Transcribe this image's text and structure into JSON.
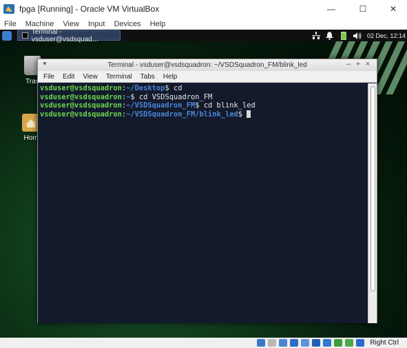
{
  "host_window": {
    "title": "fpga [Running] - Oracle VM VirtualBox",
    "controls": {
      "minimize": "—",
      "maximize": "☐",
      "close": "✕"
    },
    "menu": [
      "File",
      "Machine",
      "View",
      "Input",
      "Devices",
      "Help"
    ]
  },
  "guest_panel": {
    "task_label": "Terminal - vsduser@vsdsquad…",
    "clock": "02 Dec, 12:14"
  },
  "desktop": {
    "icons": [
      {
        "label": "Tras"
      },
      {
        "label": "Hom"
      }
    ]
  },
  "terminal": {
    "title": "Terminal - vsduser@vsdsquadron: ~/VSDSquadron_FM/blink_led",
    "controls": {
      "minimize": "‒",
      "maximize": "+",
      "close": "×"
    },
    "menu": [
      "File",
      "Edit",
      "View",
      "Terminal",
      "Tabs",
      "Help"
    ],
    "lines": [
      {
        "user": "vsduser@vsdsquadron",
        "sep": ":",
        "path": "~/Desktop",
        "prompt": "$ ",
        "cmd": "cd"
      },
      {
        "user": "vsduser@vsdsquadron",
        "sep": ":",
        "path": "~",
        "prompt": "$ ",
        "cmd": "cd VSDSquadron_FM"
      },
      {
        "user": "vsduser@vsdsquadron",
        "sep": ":",
        "path": "~/VSDSquadron_FM",
        "prompt": "$ ",
        "cmd": "cd blink_led"
      },
      {
        "user": "vsduser@vsdsquadron",
        "sep": ":",
        "path": "~/VSDSquadron_FM/blink_led",
        "prompt": "$ ",
        "cmd": ""
      }
    ]
  },
  "statusbar": {
    "host_key": "Right Ctrl",
    "icons": [
      {
        "name": "network-icon",
        "color": "#3d78c8"
      },
      {
        "name": "optical-drive-icon",
        "color": "#b8b8b8"
      },
      {
        "name": "audio-icon",
        "color": "#4b84d0"
      },
      {
        "name": "usb-icon",
        "color": "#2d6cc0"
      },
      {
        "name": "shared-folders-icon",
        "color": "#5f95d8"
      },
      {
        "name": "display-icon",
        "color": "#1f5fb8"
      },
      {
        "name": "video-capture-icon",
        "color": "#2e7ad0"
      },
      {
        "name": "recording-icon",
        "color": "#3aa03a"
      },
      {
        "name": "mouse-integration-icon",
        "color": "#4ba84b"
      },
      {
        "name": "keyboard-capture-icon",
        "color": "#2a6cc8"
      }
    ]
  },
  "colors": {
    "user_prompt": "#6cd84c",
    "path_prompt": "#4a86d8",
    "terminal_bg": "#131a2c"
  }
}
